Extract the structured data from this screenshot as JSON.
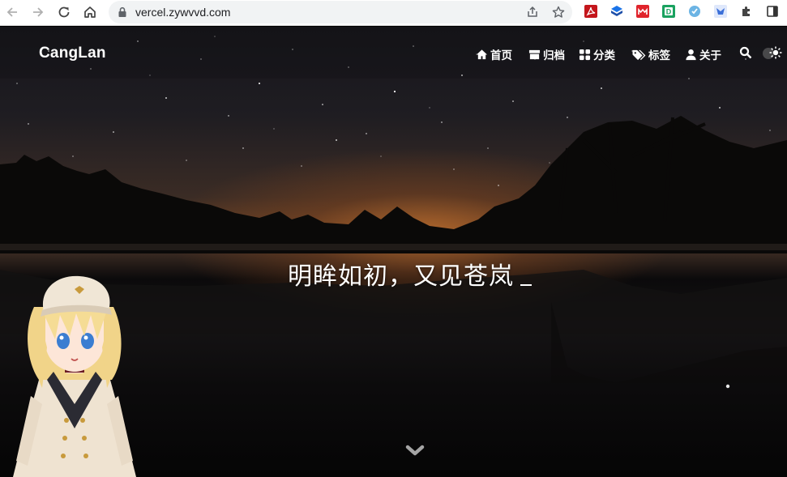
{
  "browser": {
    "url": "vercel.zywvvd.com"
  },
  "site": {
    "brand": "CangLan",
    "menu": [
      {
        "label": "首页",
        "icon": "home-icon"
      },
      {
        "label": "归档",
        "icon": "archive-icon"
      },
      {
        "label": "分类",
        "icon": "categories-icon"
      },
      {
        "label": "标签",
        "icon": "tags-icon"
      },
      {
        "label": "关于",
        "icon": "user-icon"
      }
    ],
    "hero_title": "明眸如初，又见苍岚"
  }
}
